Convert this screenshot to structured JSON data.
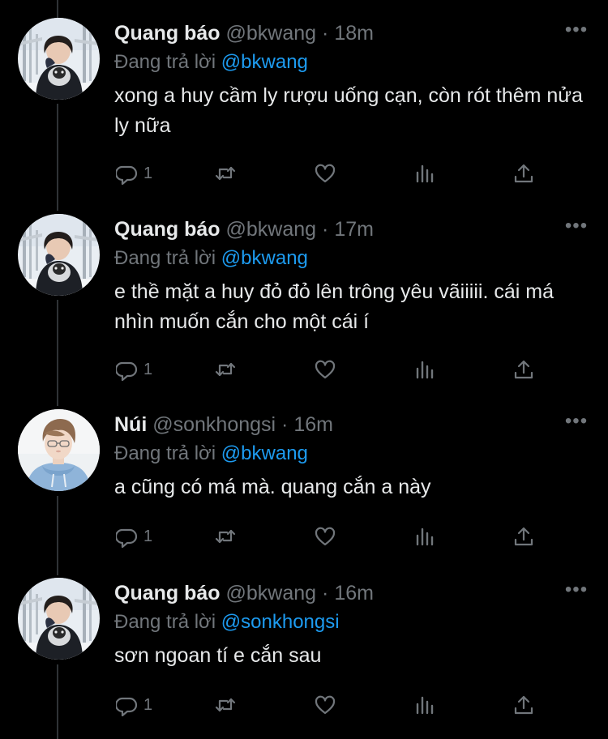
{
  "tweets": [
    {
      "name": "Quang báo",
      "handle": "@bkwang",
      "sep": "·",
      "time": "18m",
      "reply_prefix": "Đang trả lời",
      "reply_to": "@bkwang",
      "text": "xong a huy cầm ly rượu uống cạn, còn rót thêm nửa ly nữa",
      "reply_count": "1",
      "avatar": "man-holding-dog"
    },
    {
      "name": "Quang báo",
      "handle": "@bkwang",
      "sep": "·",
      "time": "17m",
      "reply_prefix": "Đang trả lời",
      "reply_to": "@bkwang",
      "text": "e thề mặt a huy đỏ đỏ lên trông yêu vãiiiii. cái má nhìn muốn cắn cho một cái í",
      "reply_count": "1",
      "avatar": "man-holding-dog"
    },
    {
      "name": "Núi",
      "handle": "@sonkhongsi",
      "sep": "·",
      "time": "16m",
      "reply_prefix": "Đang trả lời",
      "reply_to": "@bkwang",
      "text": "a cũng có má mà. quang cắn a này",
      "reply_count": "1",
      "avatar": "man-blue-hoodie"
    },
    {
      "name": "Quang báo",
      "handle": "@bkwang",
      "sep": "·",
      "time": "16m",
      "reply_prefix": "Đang trả lời",
      "reply_to": "@sonkhongsi",
      "text": "sơn ngoan tí e cắn sau",
      "reply_count": "1",
      "avatar": "man-holding-dog"
    }
  ],
  "icons": {
    "more": "more-options-icon",
    "reply": "reply-icon",
    "retweet": "retweet-icon",
    "like": "like-icon",
    "views": "views-icon",
    "share": "share-icon"
  },
  "colors": {
    "background": "#000000",
    "text": "#e7e9ea",
    "muted": "#71767b",
    "link": "#1d9bf0",
    "thread_line": "#2f3336"
  }
}
